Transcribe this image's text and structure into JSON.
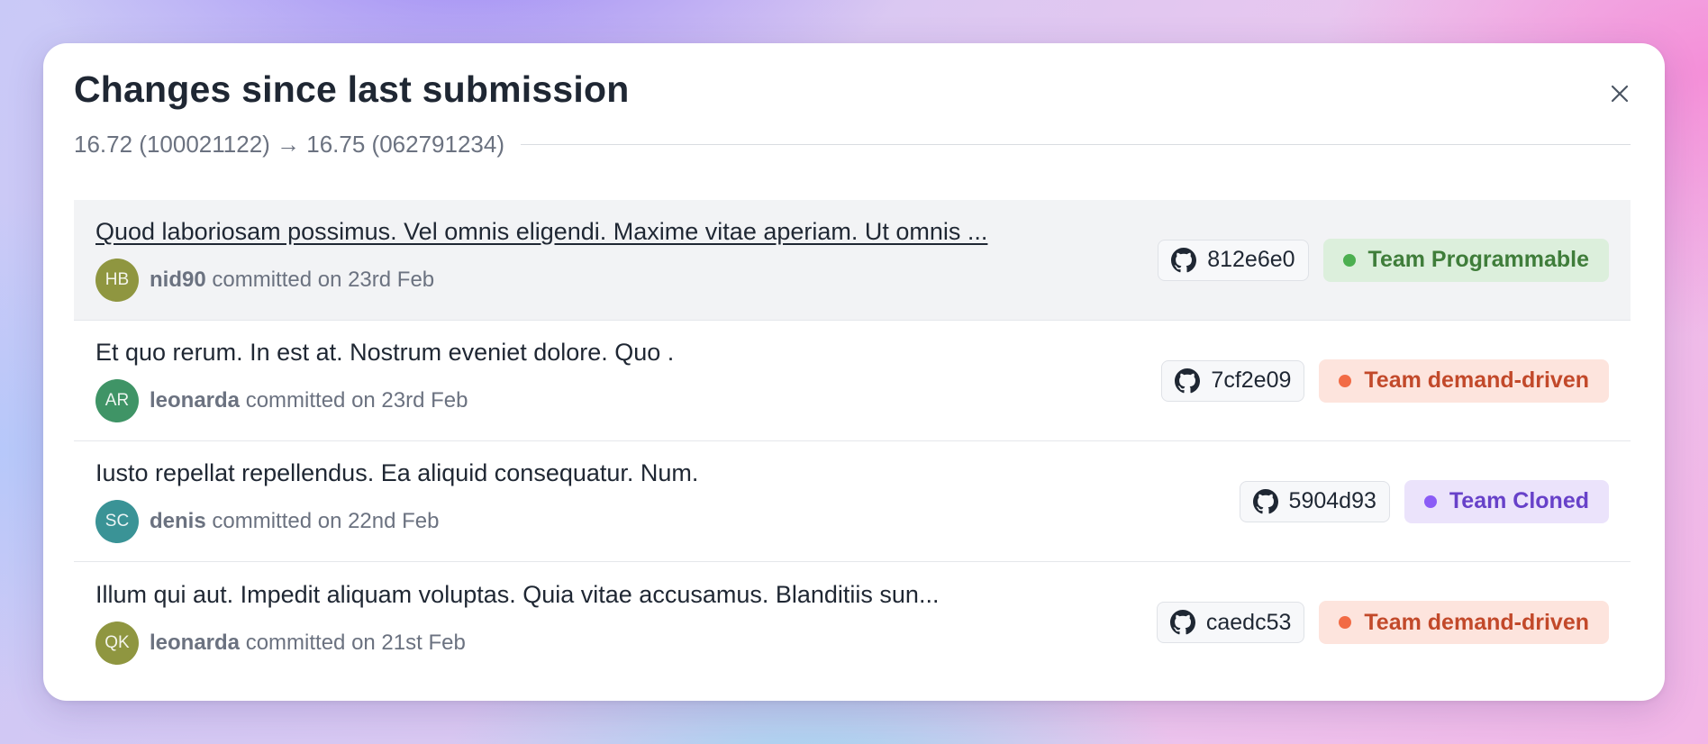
{
  "modal": {
    "title": "Changes since last submission",
    "subtitle": "16.72 (100021122) → 16.75 (062791234)",
    "close_icon": "close-icon"
  },
  "colors": {
    "green_bg": "#dcefdc",
    "green_fg": "#3f7d3a",
    "green_dot": "#4caf50",
    "red_bg": "#fde4dd",
    "red_fg": "#c2492a",
    "red_dot": "#f26b45",
    "purple_bg": "#ebe3fb",
    "purple_fg": "#6741c9",
    "purple_dot": "#8b5cf6"
  },
  "commits": [
    {
      "message": "Quod laboriosam possimus. Vel omnis eligendi. Maxime vitae aperiam. Ut omnis ...",
      "initials": "HB",
      "avatar_color": "#8f9640",
      "author": "nid90",
      "action": "committed on 23rd Feb",
      "hash": "812e6e0",
      "hash_icon": "github-icon",
      "team": "Team Programmable",
      "team_color": "green"
    },
    {
      "message": "Et quo rerum. In est at. Nostrum eveniet dolore. Quo .",
      "initials": "AR",
      "avatar_color": "#3f9466",
      "author": "leonarda",
      "action": "committed on 23rd Feb",
      "hash": "7cf2e09",
      "hash_icon": "github-icon",
      "team": "Team demand-driven",
      "team_color": "red"
    },
    {
      "message": "Iusto repellat repellendus. Ea aliquid consequatur. Num.",
      "initials": "SC",
      "avatar_color": "#3a9396",
      "author": "denis",
      "action": "committed on 22nd Feb",
      "hash": "5904d93",
      "hash_icon": "github-icon",
      "team": "Team Cloned",
      "team_color": "purple"
    },
    {
      "message": "Illum qui aut. Impedit aliquam voluptas. Quia vitae accusamus. Blanditiis sun...",
      "initials": "QK",
      "avatar_color": "#8f9640",
      "author": "leonarda",
      "action": "committed on 21st Feb",
      "hash": "caedc53",
      "hash_icon": "github-icon",
      "team": "Team demand-driven",
      "team_color": "red"
    }
  ]
}
